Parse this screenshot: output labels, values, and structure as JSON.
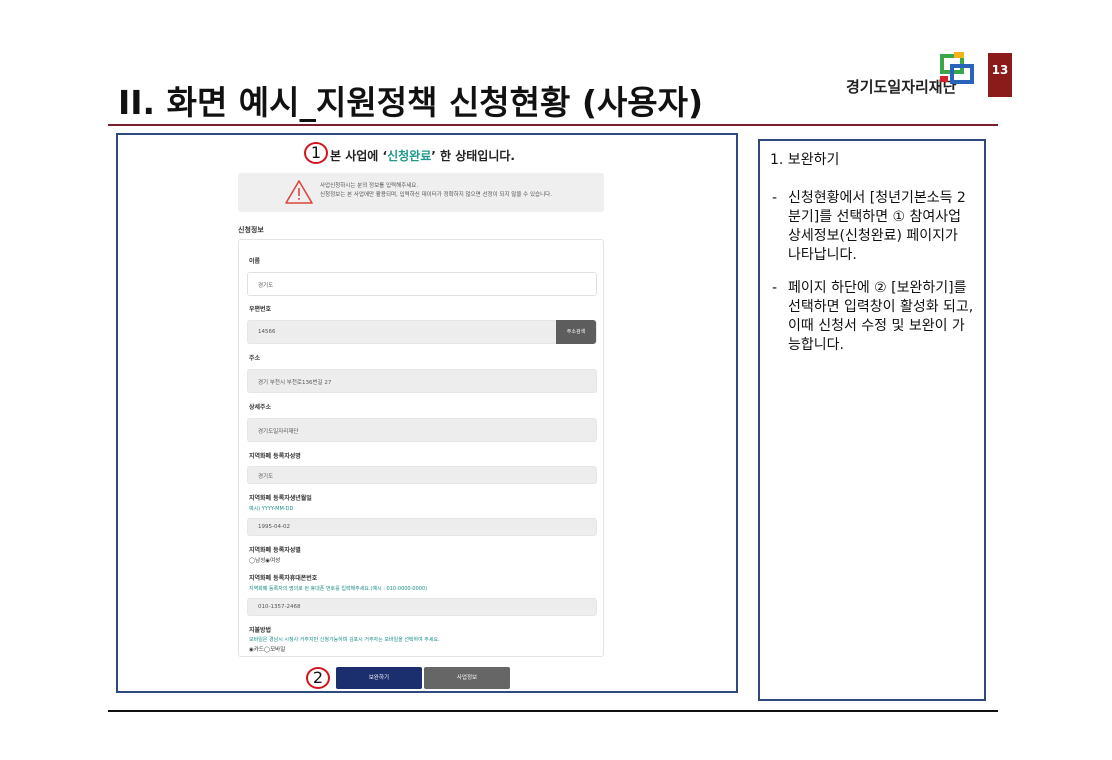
{
  "slide": {
    "title": "II. 화면 예시_지원정책 신청현황 (사용자)",
    "logo_text": "경기도일자리재단",
    "page_number": "13"
  },
  "screen": {
    "marker_1": "1",
    "marker_2": "2",
    "status_prefix": "본 사업에 ‘",
    "status_highlight": "신청완료",
    "status_suffix": "’ 한 상태입니다.",
    "alert_line1": "사업신청하시는 분의 정보를 입력해주세요.",
    "alert_line2": "신청정보는 본 사업에만 활용되며, 입력하신 데이터가 정확하지 않으면 선정이 되지 않을 수 있습니다.",
    "section_label": "신청정보",
    "fields": {
      "name_label": "이름",
      "name_value": "경기도",
      "postcode_label": "우편번호",
      "postcode_value": "14566",
      "address_search_button": "주소검색",
      "address_label": "주소",
      "address_value": "경기 부천시 부천로136번길 27",
      "detail_address_label": "상세주소",
      "detail_address_value": "경기도일자리재단",
      "registrant_name_label": "지역화폐 등록자성명",
      "registrant_name_value": "경기도",
      "birth_label": "지역화폐 등록자생년월일",
      "birth_hint": "예시) YYYY-MM-DD",
      "birth_value": "1995-04-02",
      "gender_label": "지역화폐 등록자성별",
      "gender_options": "◯남성◉여성",
      "phone_label": "지역화폐 등록자휴대폰번호",
      "phone_hint": "지역화폐 등록자의 명의로 된 휴대폰 번호를 입력해주세요.(예시 : 010-0000-0000)",
      "phone_value": "010-1357-2468",
      "payment_label": "지불방법",
      "payment_hint": "모바일은 경남시 시청사 거주지만 신청가능하며 김포시 거주자는 모바일을 선택하여 주세요.",
      "payment_options": "◉카드◯모바일"
    },
    "btn_supplement": "보완하기",
    "btn_business_info": "사업정보"
  },
  "explanation": {
    "heading": "1.  보완하기",
    "bullet1": "신청현황에서 [청년기본소득 2분기]를 선택하면 ① 참여사업 상세정보(신청완료) 페이지가 나타납니다.",
    "bullet2": "페이지 하단에 ② [보완하기]를 선택하면 입력창이 활성화 되고, 이때 신청서 수정 및 보완이 가능합니다."
  },
  "colors": {
    "frame_border": "#2f4a7e",
    "accent_teal": "#1f9a8a",
    "marker_red": "#d4141c",
    "primary_button": "#1b2f6e",
    "page_badge": "#8b1a1a"
  }
}
